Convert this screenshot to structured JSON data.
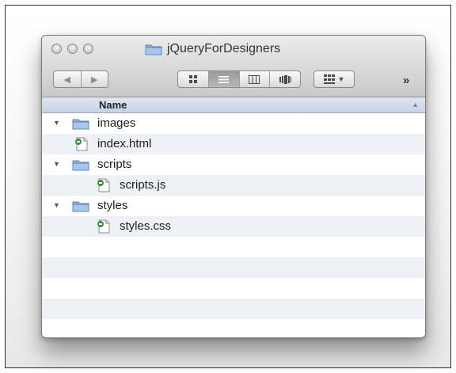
{
  "window": {
    "title": "jQueryForDesigners",
    "title_icon": "folder-icon",
    "traffic_lights": [
      "close",
      "minimize",
      "zoom"
    ]
  },
  "toolbar": {
    "back_icon": "back-arrow-icon",
    "forward_icon": "forward-arrow-icon",
    "view_modes": [
      {
        "name": "icon-view",
        "icon": "icon-view-icon",
        "active": false
      },
      {
        "name": "list-view",
        "icon": "list-view-icon",
        "active": true
      },
      {
        "name": "column-view",
        "icon": "column-view-icon",
        "active": false
      },
      {
        "name": "cover-flow-view",
        "icon": "cover-flow-icon",
        "active": false
      }
    ],
    "arrange_icon": "arrange-icon",
    "overflow_label": "»"
  },
  "columns": {
    "name_header": "Name"
  },
  "items": [
    {
      "label": "images",
      "type": "folder",
      "depth": 0,
      "expanded": true
    },
    {
      "label": "index.html",
      "type": "file",
      "depth": 0
    },
    {
      "label": "scripts",
      "type": "folder",
      "depth": 0,
      "expanded": true
    },
    {
      "label": "scripts.js",
      "type": "file",
      "depth": 1
    },
    {
      "label": "styles",
      "type": "folder",
      "depth": 0,
      "expanded": true
    },
    {
      "label": "styles.css",
      "type": "file",
      "depth": 1
    }
  ],
  "colors": {
    "header_gradient_top": "#dfe6f2",
    "header_gradient_bottom": "#c6d2e6",
    "alt_row": "#eef1f5",
    "folder_blue": "#8fb4de"
  }
}
